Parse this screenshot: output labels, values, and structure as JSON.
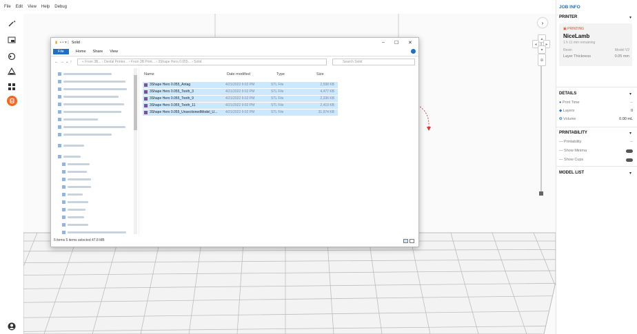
{
  "menu": [
    "File",
    "Edit",
    "View",
    "Help",
    "Debug"
  ],
  "toolbar": {
    "icons": [
      "magic-wand-icon",
      "import-icon",
      "rotate-icon",
      "support-icon",
      "grid-arrange-icon",
      "print-icon"
    ],
    "user_icon": "user-icon"
  },
  "explorer": {
    "title": "Solid",
    "ribbon": [
      "File",
      "Home",
      "Share",
      "View"
    ],
    "address": "« From 3B... › Dental Printer... › From 3B Print... › 3Shape Hero 0.055... › Solid",
    "search_placeholder": "Search Solid",
    "columns": {
      "name": "Name",
      "date": "Date modified",
      "type": "Type",
      "size": "Size"
    },
    "files": [
      {
        "name": "3Shape Hero 0.055_Antag",
        "date": "4/21/2022 9:02 PM",
        "type": "STL File",
        "size": "2,598 KB"
      },
      {
        "name": "3Shape Hero 0.055_Tooth_3",
        "date": "4/21/2022 9:02 PM",
        "type": "STL File",
        "size": "4,477 KB"
      },
      {
        "name": "3Shape Hero 0.055_Tooth_9",
        "date": "4/21/2022 9:02 PM",
        "type": "STL File",
        "size": "2,336 KB"
      },
      {
        "name": "3Shape Hero 0.055_Tooth_11",
        "date": "4/21/2022 9:02 PM",
        "type": "STL File",
        "size": "2,419 KB"
      },
      {
        "name": "3Shape Hero 0.055_UnsectionedModel_U...",
        "date": "4/21/2022 9:02 PM",
        "type": "STL File",
        "size": "31,974 KB"
      }
    ],
    "status": "5 items   5 items selected  47.8 MB"
  },
  "side": {
    "job_info": "JOB INFO",
    "printer_section": "PRINTER",
    "printing_badge": "PRINTING",
    "printer_name": "NiceLamb",
    "remaining": "1 h 11 min remaining",
    "resin_label": "Resin",
    "resin_value": "Model V2",
    "layer_label": "Layer Thickness",
    "layer_value": "0.05 mm",
    "details_section": "DETAILS",
    "print_time_label": "Print Time",
    "print_time_value": "--",
    "layers_label": "Layers",
    "layers_value": "0",
    "volume_label": "Volume",
    "volume_value": "0.00 mL",
    "printability_section": "PRINTABILITY",
    "printability_label": "Printability",
    "printability_value": "--",
    "show_minima": "Show Minima",
    "show_cups": "Show Cups",
    "model_list_section": "MODEL LIST"
  }
}
